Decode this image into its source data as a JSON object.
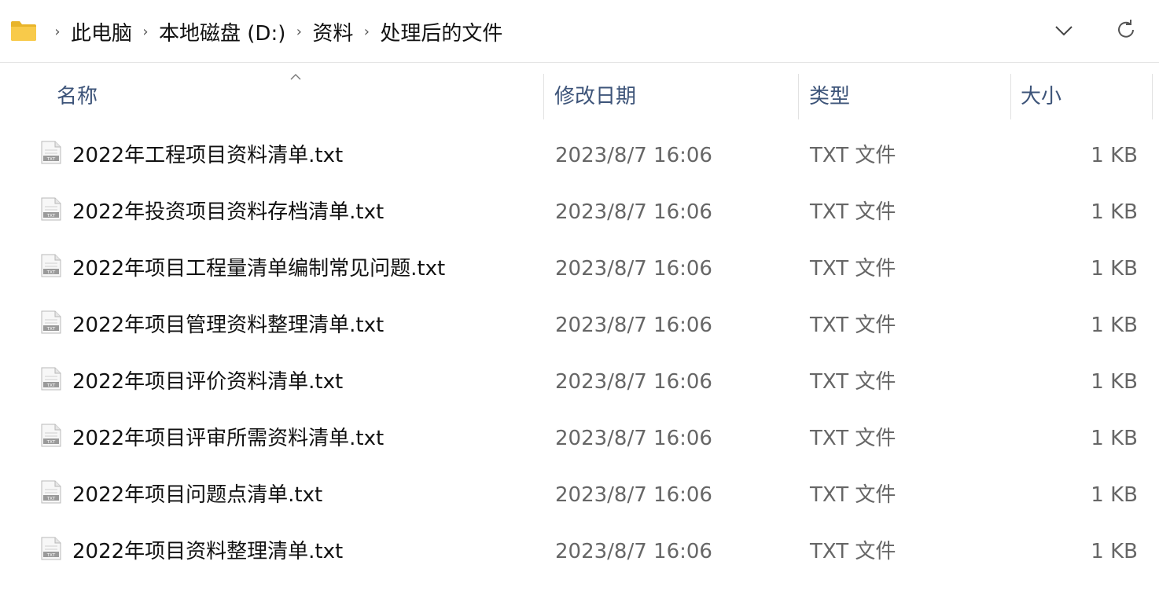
{
  "address": {
    "breadcrumbs": [
      "此电脑",
      "本地磁盘 (D:)",
      "资料",
      "处理后的文件"
    ]
  },
  "columns": {
    "name": "名称",
    "date": "修改日期",
    "type": "类型",
    "size": "大小",
    "sort_column": "name",
    "sort_direction": "ascending"
  },
  "files": [
    {
      "name": "2022年工程项目资料清单.txt",
      "date": "2023/8/7 16:06",
      "type": "TXT 文件",
      "size": "1 KB"
    },
    {
      "name": "2022年投资项目资料存档清单.txt",
      "date": "2023/8/7 16:06",
      "type": "TXT 文件",
      "size": "1 KB"
    },
    {
      "name": "2022年项目工程量清单编制常见问题.txt",
      "date": "2023/8/7 16:06",
      "type": "TXT 文件",
      "size": "1 KB"
    },
    {
      "name": "2022年项目管理资料整理清单.txt",
      "date": "2023/8/7 16:06",
      "type": "TXT 文件",
      "size": "1 KB"
    },
    {
      "name": "2022年项目评价资料清单.txt",
      "date": "2023/8/7 16:06",
      "type": "TXT 文件",
      "size": "1 KB"
    },
    {
      "name": "2022年项目评审所需资料清单.txt",
      "date": "2023/8/7 16:06",
      "type": "TXT 文件",
      "size": "1 KB"
    },
    {
      "name": "2022年项目问题点清单.txt",
      "date": "2023/8/7 16:06",
      "type": "TXT 文件",
      "size": "1 KB"
    },
    {
      "name": "2022年项目资料整理清单.txt",
      "date": "2023/8/7 16:06",
      "type": "TXT 文件",
      "size": "1 KB"
    }
  ],
  "icons": {
    "folder": "folder-icon",
    "file": "txt-file-icon",
    "separator": "chevron-right-icon",
    "dropdown": "chevron-down-icon",
    "refresh": "refresh-icon",
    "sort": "sort-ascending-icon"
  },
  "colors": {
    "folder": "#f0c040",
    "header_text": "#3d5479"
  }
}
